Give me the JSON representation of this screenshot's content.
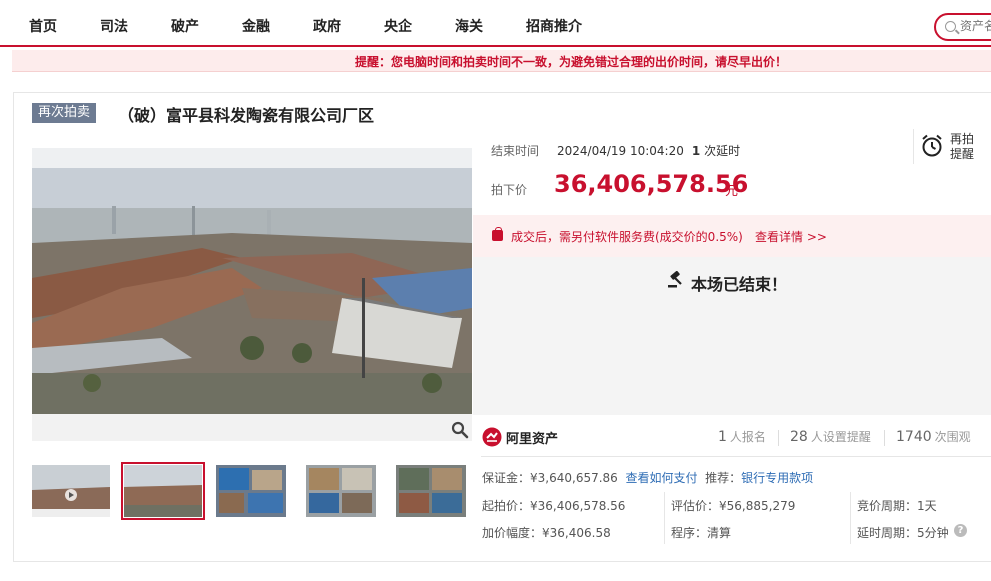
{
  "nav": {
    "items": [
      "首页",
      "司法",
      "破产",
      "金融",
      "政府",
      "央企",
      "海关",
      "招商推介"
    ],
    "search_placeholder": "资产名"
  },
  "warning": "提醒：您电脑时间和拍卖时间不一致，为避免错过合理的出价时间，请尽早出价！",
  "auction": {
    "badge": "再次拍卖",
    "title": "（破）富平县科发陶瓷有限公司厂区",
    "end_time_label": "结束时间",
    "end_time": "2024/04/19 10:04:20",
    "delay_count": "1",
    "delay_text": "次延时",
    "reminder_label": "再拍提醒",
    "price_label": "拍下价",
    "price": "36,406,578.56",
    "price_unit": "元",
    "fee_text": "成交后，需另付软件服务费(成交价的0.5%)",
    "fee_link": "查看详情 >>",
    "ended_text": "本场已结束！"
  },
  "platform": {
    "name": "阿里资产",
    "signups": "1",
    "signups_label": "人报名",
    "reminders": "28",
    "reminders_label": "人设置提醒",
    "watchers": "1740",
    "watchers_label": "次围观"
  },
  "details": {
    "deposit_label": "保证金：",
    "deposit": "¥3,640,657.86",
    "deposit_link": "查看如何支付",
    "recommend_label": "推荐：",
    "recommend_link": "银行专用款项",
    "start_price": "起拍价：¥36,406,578.56",
    "increment": "加价幅度：¥36,406.58",
    "appraisal": "评估价：¥56,885,279",
    "procedure": "程序：清算",
    "bid_period": "竞价周期：1天",
    "delay_period": "延时周期：5分钟"
  },
  "colors": {
    "accent": "#c8102e",
    "link": "#2f6db5",
    "badge": "#6d7b92"
  }
}
